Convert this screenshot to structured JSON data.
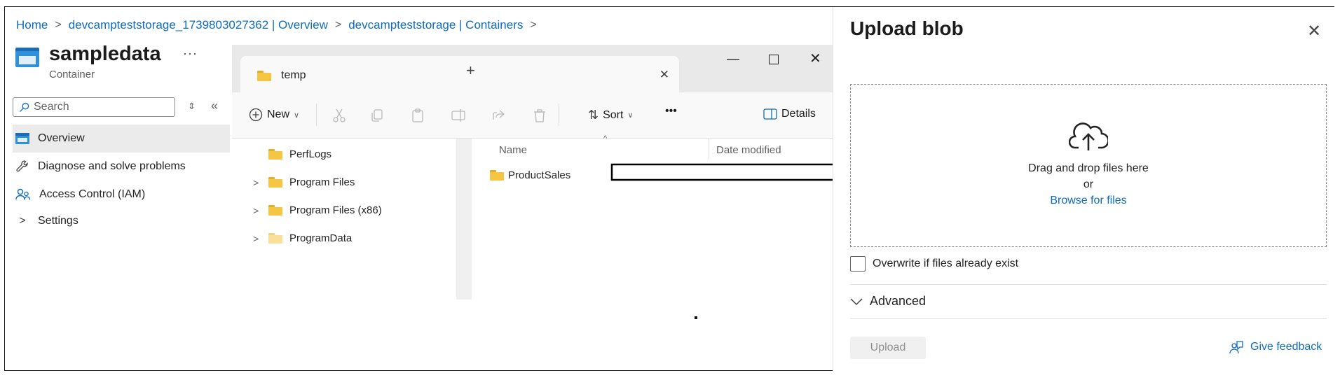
{
  "breadcrumb": {
    "items": [
      "Home",
      "devcampteststorage_1739803027362 | Overview",
      "devcampteststorage | Containers"
    ]
  },
  "blade": {
    "title": "sampledata",
    "subtitle": "Container",
    "more": "···",
    "search_placeholder": "Search",
    "nav": [
      {
        "label": "Overview",
        "icon": "container-icon"
      },
      {
        "label": "Diagnose and solve problems",
        "icon": "wrench-icon"
      },
      {
        "label": "Access Control (IAM)",
        "icon": "people-icon"
      },
      {
        "label": "Settings",
        "icon": "chevron-right-icon"
      }
    ]
  },
  "explorer": {
    "tab_title": "temp",
    "toolbar": {
      "new": "New",
      "sort": "Sort",
      "more": "•••",
      "details": "Details"
    },
    "tree": [
      "PerfLogs",
      "Program Files",
      "Program Files (x86)",
      "ProgramData"
    ],
    "columns": {
      "name": "Name",
      "date_modified": "Date modified"
    },
    "files": [
      "ProductSales"
    ]
  },
  "upload_panel": {
    "title": "Upload blob",
    "drop_line1": "Drag and drop files here",
    "drop_or": "or",
    "browse": "Browse for files",
    "overwrite": "Overwrite if files already exist",
    "advanced": "Advanced",
    "upload_button": "Upload",
    "feedback": "Give feedback"
  },
  "colors": {
    "link": "#0f6cbd",
    "folder": "#f5c643",
    "azure_blue": "#2f8fd9"
  }
}
